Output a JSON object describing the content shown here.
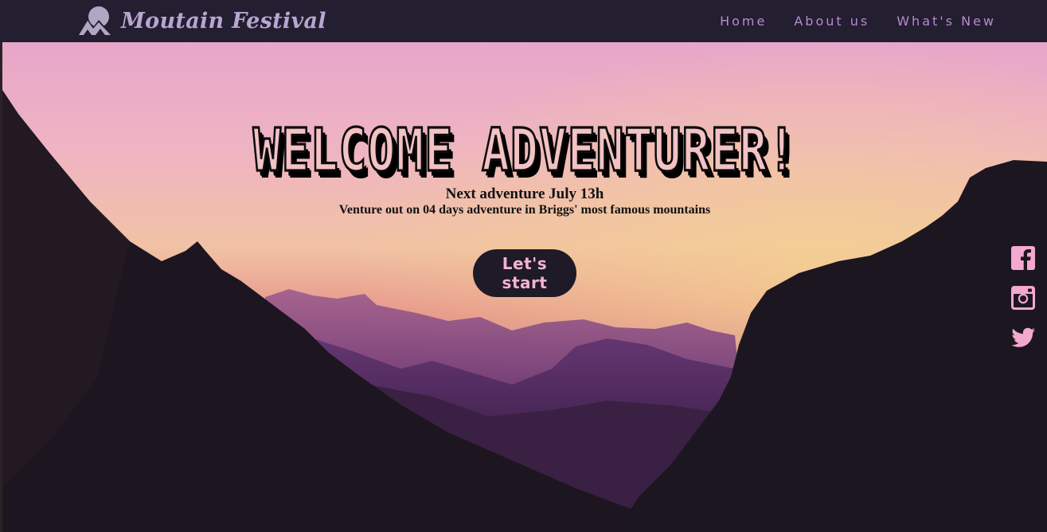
{
  "header": {
    "brand": "Moutain Festival",
    "nav": [
      {
        "label": "Home"
      },
      {
        "label": "About us"
      },
      {
        "label": "What's New"
      }
    ]
  },
  "hero": {
    "title": "WELCOME ADVENTURER!",
    "date": "Next adventure July 13h",
    "subtitle": "Venture out on 04 days adventure in Briggs' most famous mountains",
    "cta": "Let's start"
  },
  "social": [
    {
      "icon": "facebook-icon"
    },
    {
      "icon": "instagram-icon"
    },
    {
      "icon": "twitter-icon"
    }
  ],
  "colors": {
    "header_bg": "#231e30",
    "brand": "#b7a6cf",
    "nav": "#b88ad0",
    "accent_pink": "#f4b3cf",
    "button_bg": "#1f1a28",
    "social_icon": "#f3a8cf"
  }
}
